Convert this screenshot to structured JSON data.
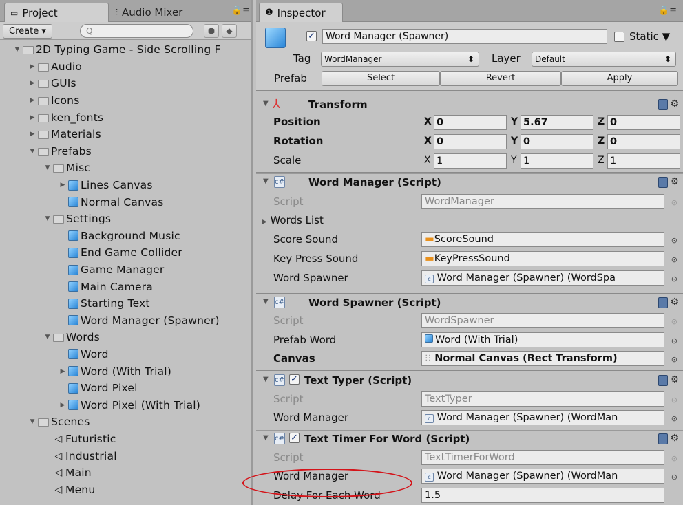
{
  "left_panel": {
    "tabs": {
      "project": "Project",
      "audio_mixer": "Audio Mixer"
    },
    "create_label": "Create",
    "search_placeholder": "Q",
    "tree": [
      {
        "indent": 0,
        "arrow": "open",
        "icon": "folder",
        "label": "2D Typing Game - Side Scrolling F"
      },
      {
        "indent": 1,
        "arrow": "closed",
        "icon": "folder",
        "label": "Audio"
      },
      {
        "indent": 1,
        "arrow": "closed",
        "icon": "folder",
        "label": "GUIs"
      },
      {
        "indent": 1,
        "arrow": "closed",
        "icon": "folder",
        "label": "Icons"
      },
      {
        "indent": 1,
        "arrow": "closed",
        "icon": "folder",
        "label": "ken_fonts"
      },
      {
        "indent": 1,
        "arrow": "closed",
        "icon": "folder",
        "label": "Materials"
      },
      {
        "indent": 1,
        "arrow": "open",
        "icon": "folder",
        "label": "Prefabs"
      },
      {
        "indent": 2,
        "arrow": "open",
        "icon": "folder",
        "label": "Misc"
      },
      {
        "indent": 3,
        "arrow": "closed",
        "icon": "prefab",
        "label": "Lines Canvas"
      },
      {
        "indent": 3,
        "arrow": "none",
        "icon": "prefab",
        "label": "Normal Canvas"
      },
      {
        "indent": 2,
        "arrow": "open",
        "icon": "folder",
        "label": "Settings"
      },
      {
        "indent": 3,
        "arrow": "none",
        "icon": "prefab",
        "label": "Background Music"
      },
      {
        "indent": 3,
        "arrow": "none",
        "icon": "prefab",
        "label": "End Game Collider"
      },
      {
        "indent": 3,
        "arrow": "none",
        "icon": "prefab",
        "label": "Game Manager"
      },
      {
        "indent": 3,
        "arrow": "none",
        "icon": "prefab",
        "label": "Main Camera"
      },
      {
        "indent": 3,
        "arrow": "none",
        "icon": "prefab",
        "label": "Starting Text"
      },
      {
        "indent": 3,
        "arrow": "none",
        "icon": "prefab",
        "label": "Word Manager (Spawner)"
      },
      {
        "indent": 2,
        "arrow": "open",
        "icon": "folder",
        "label": "Words"
      },
      {
        "indent": 3,
        "arrow": "none",
        "icon": "prefab",
        "label": "Word"
      },
      {
        "indent": 3,
        "arrow": "closed",
        "icon": "prefab",
        "label": "Word (With Trial)"
      },
      {
        "indent": 3,
        "arrow": "none",
        "icon": "prefab",
        "label": "Word Pixel"
      },
      {
        "indent": 3,
        "arrow": "closed",
        "icon": "prefab",
        "label": "Word Pixel (With Trial)"
      },
      {
        "indent": 1,
        "arrow": "open",
        "icon": "folder",
        "label": "Scenes"
      },
      {
        "indent": 2,
        "arrow": "none",
        "icon": "unity",
        "label": "Futuristic"
      },
      {
        "indent": 2,
        "arrow": "none",
        "icon": "unity",
        "label": "Industrial"
      },
      {
        "indent": 2,
        "arrow": "none",
        "icon": "unity",
        "label": "Main"
      },
      {
        "indent": 2,
        "arrow": "none",
        "icon": "unity",
        "label": "Menu"
      }
    ]
  },
  "inspector": {
    "tab": "Inspector",
    "object_name": "Word Manager (Spawner)",
    "static_label": "Static",
    "tag_label": "Tag",
    "tag_value": "WordManager",
    "layer_label": "Layer",
    "layer_value": "Default",
    "prefab_label": "Prefab",
    "select_label": "Select",
    "revert_label": "Revert",
    "apply_label": "Apply",
    "transform": {
      "title": "Transform",
      "position_label": "Position",
      "rotation_label": "Rotation",
      "scale_label": "Scale",
      "x": "X",
      "y": "Y",
      "z": "Z",
      "position": [
        "0",
        "5.67",
        "0"
      ],
      "rotation": [
        "0",
        "0",
        "0"
      ],
      "scale": [
        "1",
        "1",
        "1"
      ]
    },
    "word_manager": {
      "title": "Word Manager (Script)",
      "script_label": "Script",
      "script_value": "WordManager",
      "words_list_label": "Words List",
      "score_sound_label": "Score Sound",
      "score_sound_value": "ScoreSound",
      "key_press_label": "Key Press Sound",
      "key_press_value": "KeyPressSound",
      "spawner_label": "Word Spawner",
      "spawner_value": "Word Manager (Spawner) (WordSpa"
    },
    "word_spawner": {
      "title": "Word Spawner (Script)",
      "script_label": "Script",
      "script_value": "WordSpawner",
      "prefab_word_label": "Prefab Word",
      "prefab_word_value": "Word (With Trial)",
      "canvas_label": "Canvas",
      "canvas_value": "Normal Canvas (Rect Transform)"
    },
    "text_typer": {
      "title": "Text Typer (Script)",
      "script_label": "Script",
      "script_value": "TextTyper",
      "wm_label": "Word Manager",
      "wm_value": "Word Manager (Spawner) (WordMan"
    },
    "text_timer": {
      "title": "Text Timer For Word (Script)",
      "script_label": "Script",
      "script_value": "TextTimerForWord",
      "wm_label": "Word Manager",
      "wm_value": "Word Manager (Spawner) (WordMan",
      "delay_label": "Delay For Each Word",
      "delay_value": "1.5"
    }
  },
  "colors": {
    "highlight_circle": "#d4141a",
    "prefab_blue": "#2b86d6"
  }
}
